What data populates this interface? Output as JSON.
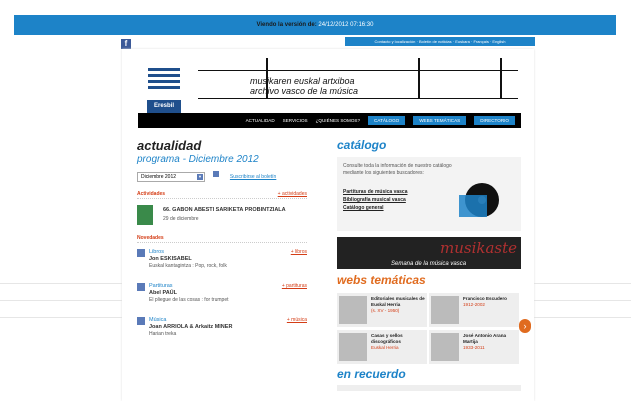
{
  "archive_bar": {
    "label": "Viendo la versión de:",
    "date": "24/12/2012 07:16:30"
  },
  "facebook": {
    "icon": "facebook-icon"
  },
  "top_links": [
    "Contacto y localización",
    "Boletín de noticias",
    "Euskara",
    "Français",
    "English"
  ],
  "header": {
    "logo_text": "Eresbil",
    "title_line1": "musikaren euskal artxiboa",
    "title_line2": "archivo vasco de la música"
  },
  "nav": {
    "items": [
      {
        "label": "ACTUALIDAD",
        "style": "plain"
      },
      {
        "label": "SERVICIOS",
        "style": "plain"
      },
      {
        "label": "¿QUIÉNES SOMOS?",
        "style": "plain"
      },
      {
        "label": "CATÁLOGO",
        "style": "blue"
      },
      {
        "label": "WEBS TEMÁTICAS",
        "style": "blue"
      },
      {
        "label": "DIRECTORIO",
        "style": "blue"
      }
    ]
  },
  "left": {
    "title": "actualidad",
    "subtitle": "programa - Diciembre 2012",
    "month_select": "Diciembre 2012",
    "subscribe": "Suscribirse al boletín",
    "activities_title": "Actividades",
    "activities_more": "+ actividades",
    "activity": {
      "title": "66. GABON ABESTI SARIKETA PROBINTZIALA",
      "date": "29 de diciembre"
    },
    "news_title": "Novedades",
    "news": [
      {
        "cat": "Libros",
        "more": "+ libros",
        "title": "Jon ESKISABEL",
        "desc": "Euskal kantagintza : Pop, rock, folk",
        "icon": "book-icon"
      },
      {
        "cat": "Partituras",
        "more": "+ partituras",
        "title": "Abel PAÚL",
        "desc": "El pliegue de las cosas : for trumpet",
        "icon": "score-icon"
      },
      {
        "cat": "Música",
        "more": "+ música",
        "title": "Joan ARRIOLA & Arkaitz MINER",
        "desc": "Harian treka",
        "icon": "music-icon"
      }
    ]
  },
  "right": {
    "catalogo_title": "catálogo",
    "catalogo_intro": "Consulte toda la información de nuestro catálogo mediante los siguientes buscadores:",
    "catalogo_links": [
      "Partituras de música vasca",
      "Bibliografía musical vasca",
      "Catálogo general"
    ],
    "musikaste_word": "musikaste",
    "musikaste_sub": "Semana de la música vasca",
    "webs_title": "webs temáticas",
    "webs": [
      {
        "title": "Editoriales musicales de Euskal Herria",
        "sub": "(s. XV - 1950)"
      },
      {
        "title": "Francisco Escudero",
        "sub": "1912-2002"
      },
      {
        "title": "Casas y sellos discográficos",
        "sub": "Euskal Herria"
      },
      {
        "title": "José Antonio Arana Martija",
        "sub": "1933-2011"
      }
    ],
    "recuerdo_title": "en recuerdo"
  }
}
